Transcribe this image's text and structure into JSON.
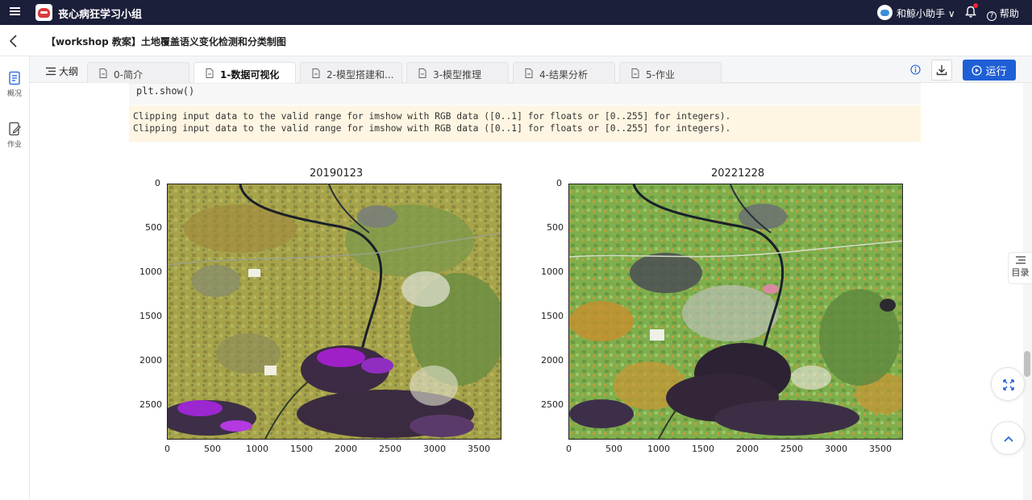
{
  "topbar": {
    "brand": "丧心病狂学习小组",
    "user": "和鲸小助手 ∨",
    "help": "帮助"
  },
  "titlebar": {
    "title": "【workshop 教案】土地覆盖语义变化检测和分类制图"
  },
  "sidebar": {
    "items": [
      {
        "label": "概况"
      },
      {
        "label": "作业"
      }
    ]
  },
  "tabs": {
    "outline": "大纲",
    "items": [
      {
        "label": "0-简介"
      },
      {
        "label": "1-数据可视化",
        "active": true
      },
      {
        "label": "2-模型搭建和..."
      },
      {
        "label": "3-模型推理"
      },
      {
        "label": "4-结果分析"
      },
      {
        "label": "5-作业"
      }
    ],
    "run_label": "运行"
  },
  "cell": {
    "code": "plt.show()",
    "stderr": [
      "Clipping input data to the valid range for imshow with RGB data ([0..1] for floats or [0..255] for integers).",
      "Clipping input data to the valid range for imshow with RGB data ([0..1] for floats or [0..255] for integers)."
    ]
  },
  "plots": [
    {
      "title": "20190123",
      "x_ticks": [
        "0",
        "500",
        "1000",
        "1500",
        "2000",
        "2500",
        "3000",
        "3500"
      ],
      "y_ticks": [
        "0",
        "500",
        "1000",
        "1500",
        "2000",
        "2500"
      ]
    },
    {
      "title": "20221228",
      "x_ticks": [
        "0",
        "500",
        "1000",
        "1500",
        "2000",
        "2500",
        "3000",
        "3500"
      ],
      "y_ticks": [
        "0",
        "500",
        "1000",
        "1500",
        "2000",
        "2500"
      ]
    }
  ],
  "toc": {
    "label": "目录"
  },
  "colors": {
    "topbar": "#1c1f3a",
    "primary": "#1f5fd6",
    "stderr_bg": "#fef6e3",
    "notification_dot": "#f5222d"
  },
  "icons": [
    "menu-icon",
    "logo-icon",
    "bell-icon",
    "help-icon",
    "back-icon",
    "outline-icon",
    "file-icon",
    "info-icon",
    "download-icon",
    "play-icon",
    "overview-icon",
    "homework-icon",
    "toc-icon",
    "expand-icon",
    "arrow-up-icon"
  ]
}
